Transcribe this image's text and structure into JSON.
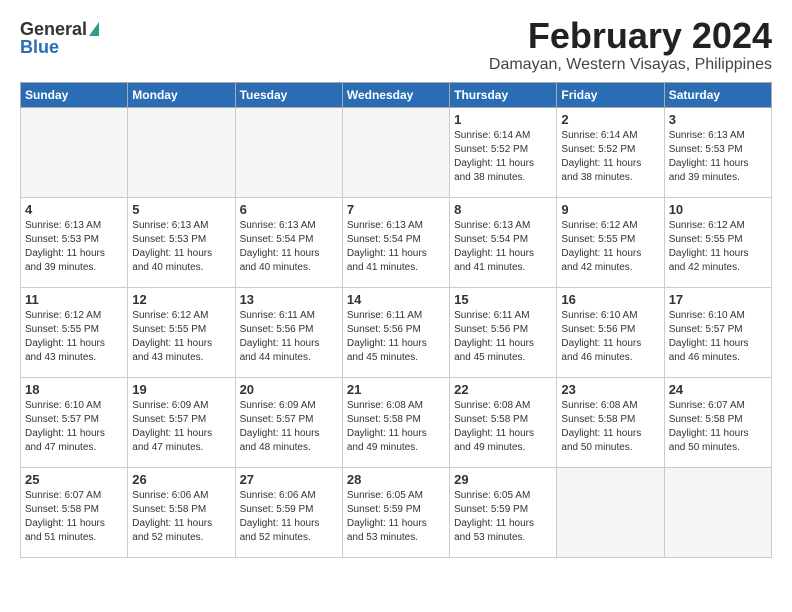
{
  "header": {
    "logo_general": "General",
    "logo_blue": "Blue",
    "title": "February 2024",
    "location": "Damayan, Western Visayas, Philippines"
  },
  "weekdays": [
    "Sunday",
    "Monday",
    "Tuesday",
    "Wednesday",
    "Thursday",
    "Friday",
    "Saturday"
  ],
  "weeks": [
    [
      {
        "day": "",
        "info": ""
      },
      {
        "day": "",
        "info": ""
      },
      {
        "day": "",
        "info": ""
      },
      {
        "day": "",
        "info": ""
      },
      {
        "day": "1",
        "info": "Sunrise: 6:14 AM\nSunset: 5:52 PM\nDaylight: 11 hours\nand 38 minutes."
      },
      {
        "day": "2",
        "info": "Sunrise: 6:14 AM\nSunset: 5:52 PM\nDaylight: 11 hours\nand 38 minutes."
      },
      {
        "day": "3",
        "info": "Sunrise: 6:13 AM\nSunset: 5:53 PM\nDaylight: 11 hours\nand 39 minutes."
      }
    ],
    [
      {
        "day": "4",
        "info": "Sunrise: 6:13 AM\nSunset: 5:53 PM\nDaylight: 11 hours\nand 39 minutes."
      },
      {
        "day": "5",
        "info": "Sunrise: 6:13 AM\nSunset: 5:53 PM\nDaylight: 11 hours\nand 40 minutes."
      },
      {
        "day": "6",
        "info": "Sunrise: 6:13 AM\nSunset: 5:54 PM\nDaylight: 11 hours\nand 40 minutes."
      },
      {
        "day": "7",
        "info": "Sunrise: 6:13 AM\nSunset: 5:54 PM\nDaylight: 11 hours\nand 41 minutes."
      },
      {
        "day": "8",
        "info": "Sunrise: 6:13 AM\nSunset: 5:54 PM\nDaylight: 11 hours\nand 41 minutes."
      },
      {
        "day": "9",
        "info": "Sunrise: 6:12 AM\nSunset: 5:55 PM\nDaylight: 11 hours\nand 42 minutes."
      },
      {
        "day": "10",
        "info": "Sunrise: 6:12 AM\nSunset: 5:55 PM\nDaylight: 11 hours\nand 42 minutes."
      }
    ],
    [
      {
        "day": "11",
        "info": "Sunrise: 6:12 AM\nSunset: 5:55 PM\nDaylight: 11 hours\nand 43 minutes."
      },
      {
        "day": "12",
        "info": "Sunrise: 6:12 AM\nSunset: 5:55 PM\nDaylight: 11 hours\nand 43 minutes."
      },
      {
        "day": "13",
        "info": "Sunrise: 6:11 AM\nSunset: 5:56 PM\nDaylight: 11 hours\nand 44 minutes."
      },
      {
        "day": "14",
        "info": "Sunrise: 6:11 AM\nSunset: 5:56 PM\nDaylight: 11 hours\nand 45 minutes."
      },
      {
        "day": "15",
        "info": "Sunrise: 6:11 AM\nSunset: 5:56 PM\nDaylight: 11 hours\nand 45 minutes."
      },
      {
        "day": "16",
        "info": "Sunrise: 6:10 AM\nSunset: 5:56 PM\nDaylight: 11 hours\nand 46 minutes."
      },
      {
        "day": "17",
        "info": "Sunrise: 6:10 AM\nSunset: 5:57 PM\nDaylight: 11 hours\nand 46 minutes."
      }
    ],
    [
      {
        "day": "18",
        "info": "Sunrise: 6:10 AM\nSunset: 5:57 PM\nDaylight: 11 hours\nand 47 minutes."
      },
      {
        "day": "19",
        "info": "Sunrise: 6:09 AM\nSunset: 5:57 PM\nDaylight: 11 hours\nand 47 minutes."
      },
      {
        "day": "20",
        "info": "Sunrise: 6:09 AM\nSunset: 5:57 PM\nDaylight: 11 hours\nand 48 minutes."
      },
      {
        "day": "21",
        "info": "Sunrise: 6:08 AM\nSunset: 5:58 PM\nDaylight: 11 hours\nand 49 minutes."
      },
      {
        "day": "22",
        "info": "Sunrise: 6:08 AM\nSunset: 5:58 PM\nDaylight: 11 hours\nand 49 minutes."
      },
      {
        "day": "23",
        "info": "Sunrise: 6:08 AM\nSunset: 5:58 PM\nDaylight: 11 hours\nand 50 minutes."
      },
      {
        "day": "24",
        "info": "Sunrise: 6:07 AM\nSunset: 5:58 PM\nDaylight: 11 hours\nand 50 minutes."
      }
    ],
    [
      {
        "day": "25",
        "info": "Sunrise: 6:07 AM\nSunset: 5:58 PM\nDaylight: 11 hours\nand 51 minutes."
      },
      {
        "day": "26",
        "info": "Sunrise: 6:06 AM\nSunset: 5:58 PM\nDaylight: 11 hours\nand 52 minutes."
      },
      {
        "day": "27",
        "info": "Sunrise: 6:06 AM\nSunset: 5:59 PM\nDaylight: 11 hours\nand 52 minutes."
      },
      {
        "day": "28",
        "info": "Sunrise: 6:05 AM\nSunset: 5:59 PM\nDaylight: 11 hours\nand 53 minutes."
      },
      {
        "day": "29",
        "info": "Sunrise: 6:05 AM\nSunset: 5:59 PM\nDaylight: 11 hours\nand 53 minutes."
      },
      {
        "day": "",
        "info": ""
      },
      {
        "day": "",
        "info": ""
      }
    ]
  ]
}
